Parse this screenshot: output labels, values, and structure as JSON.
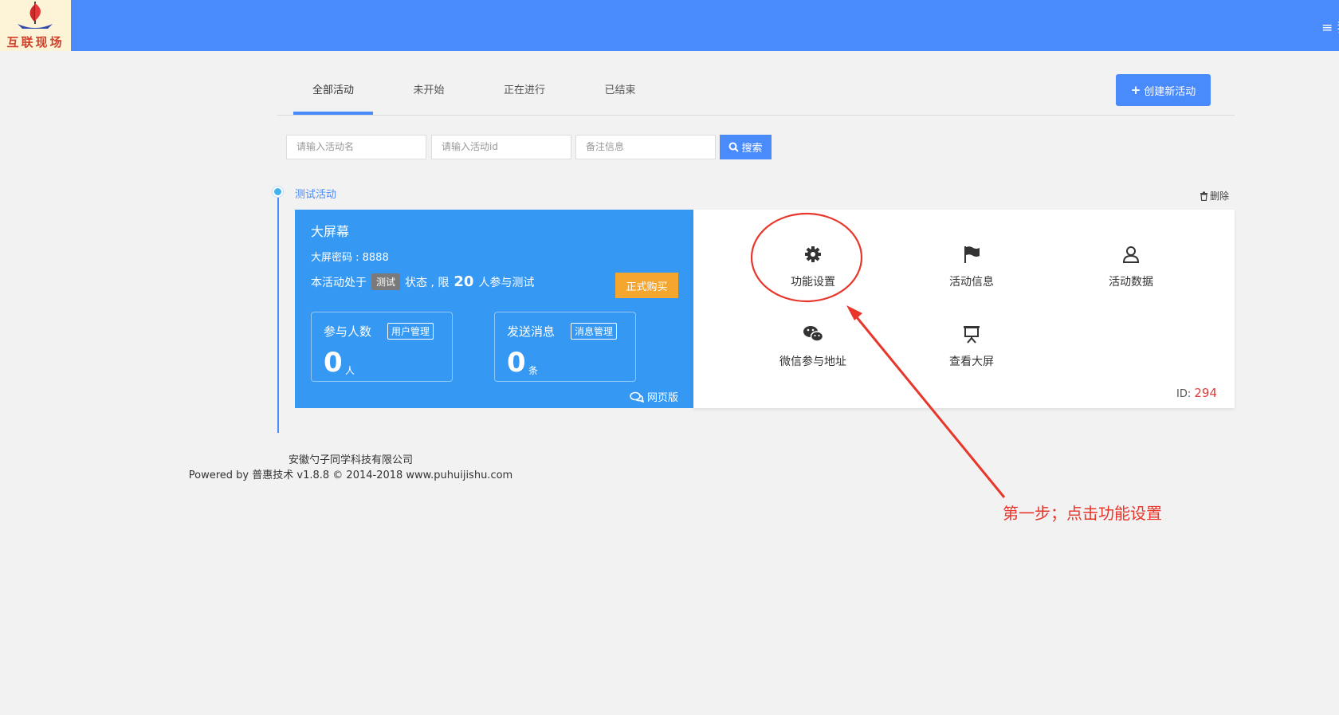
{
  "header": {
    "logo_text": "互联现场",
    "menu_label": "≡ 我"
  },
  "tabs": [
    {
      "label": "全部活动",
      "active": true
    },
    {
      "label": "未开始",
      "active": false
    },
    {
      "label": "正在进行",
      "active": false
    },
    {
      "label": "已结束",
      "active": false
    }
  ],
  "create_button": {
    "label": "创建新活动"
  },
  "search": {
    "name_placeholder": "请输入活动名",
    "id_placeholder": "请输入活动id",
    "remark_placeholder": "备注信息",
    "button_label": "搜索"
  },
  "activity": {
    "name": "测试活动",
    "delete_label": "删除",
    "title": "大屏幕",
    "password_text": "大屏密码 : 8888",
    "status_prefix": "本活动处于",
    "status_badge": "测试",
    "status_mid": "状态 , 限",
    "limit": "20",
    "status_suffix": "人参与测试",
    "buy_label": "正式购买",
    "participants": {
      "label": "参与人数",
      "tag": "用户管理",
      "value": "0",
      "unit": "人"
    },
    "messages": {
      "label": "发送消息",
      "tag": "消息管理",
      "value": "0",
      "unit": "条"
    },
    "web_label": "网页版",
    "functions": [
      {
        "label": "功能设置",
        "icon": "gear-icon"
      },
      {
        "label": "活动信息",
        "icon": "flag-icon"
      },
      {
        "label": "活动数据",
        "icon": "user-icon"
      },
      {
        "label": "微信参与地址",
        "icon": "wechat-icon"
      },
      {
        "label": "查看大屏",
        "icon": "screen-icon"
      }
    ],
    "id_label": "ID:",
    "id_value": "294"
  },
  "footer": {
    "company": "安徽勺子同学科技有限公司",
    "powered": "Powered by 普惠技术 v1.8.8 © 2014-2018 www.puhuijishu.com"
  },
  "annotation": {
    "text": "第一步；点击功能设置",
    "color": "#e8362b"
  },
  "colors": {
    "primary": "#4a8bfc",
    "card_blue": "#3598f2",
    "buy_orange": "#f4a62e",
    "id_red": "#e23a3a"
  }
}
